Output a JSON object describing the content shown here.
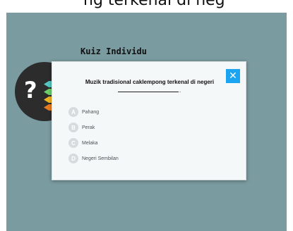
{
  "top_clipped_text": "ng terkenal di neg",
  "quiz_title": "Kuiz Individu",
  "badge": {
    "symbol": "?"
  },
  "question": {
    "text": "Muzik tradisional caklempong terkenal di negeri",
    "suffix": "."
  },
  "close_button": {
    "label": "✕",
    "icon": "close-icon"
  },
  "options": [
    {
      "letter": "A",
      "label": "Pahang"
    },
    {
      "letter": "B",
      "label": "Perak"
    },
    {
      "letter": "C",
      "label": "Melaka"
    },
    {
      "letter": "D",
      "label": "Negeri Sembilan"
    }
  ],
  "colors": {
    "background": "#7a9ba0",
    "accent": "#1aa4f2",
    "badge": "#2c2c2c",
    "ribbons": [
      "#53c7c0",
      "#6bcf6a",
      "#f0b323",
      "#ea7b1f"
    ]
  }
}
